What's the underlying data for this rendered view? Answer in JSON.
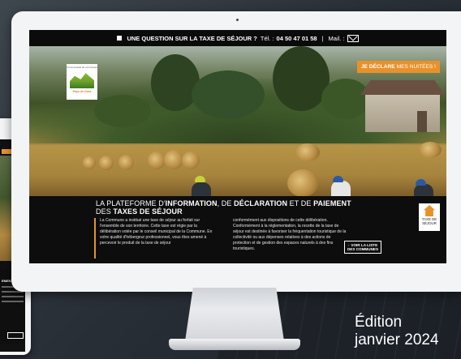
{
  "topbar": {
    "question": "UNE QUESTION SUR LA TAXE DE SÉJOUR ?",
    "tel_label": "Tél. :",
    "tel_number": "04 50 47 01 58",
    "separator": "|",
    "mail_label": "Mail. :"
  },
  "hero": {
    "cta_bold": "JE DÉCLARE",
    "cta_rest": "MES NUITÉES !"
  },
  "logo": {
    "top_text": "Communauté de communes",
    "name": "Pays de Dora"
  },
  "info": {
    "title_1": "LA PLATEFORME D'",
    "title_2": "INFORMATION",
    "title_3": ", DE ",
    "title_4": "DÉCLARATION",
    "title_5": " ET DE ",
    "title_6": "PAIEMENT",
    "title_7": "DES ",
    "title_8": "TAXES DE SÉJOUR",
    "paragraph_1": "La Commune a institué une taxe de séjour au forfait sur l'ensemble de son territoire. Cette taxe est régie par la délibération votée par le conseil municipal de la Commune. En votre qualité d'hébergeur professionnel, vous êtes amené à percevoir le produit de la taxe de séjour",
    "paragraph_2": "conformément aux dispositions de cette délibération. Conformément à la réglementation, la recette de la taxe de séjour est destinée à favoriser la fréquentation touristique de la collectivité ou aux dépenses relatives à des actions de protection et de gestion des espaces naturels à des fins touristiques.",
    "button_line1": "VOIR LA LISTE",
    "button_line2": "DES COMMUNES"
  },
  "badge": {
    "line1": "TAXE DE",
    "line2": "SÉJOUR"
  },
  "tablet": {
    "heading": "EMENT",
    "button_line1": "VOIR LA LISTE",
    "button_line2": "DES COMMUNES"
  },
  "edition": {
    "line1": "Édition",
    "line2": "janvier 2024"
  },
  "colors": {
    "accent": "#e8912b",
    "dark": "#0d0d0d"
  },
  "icons": [
    "mail-icon",
    "house-icon",
    "arrow-icon"
  ]
}
